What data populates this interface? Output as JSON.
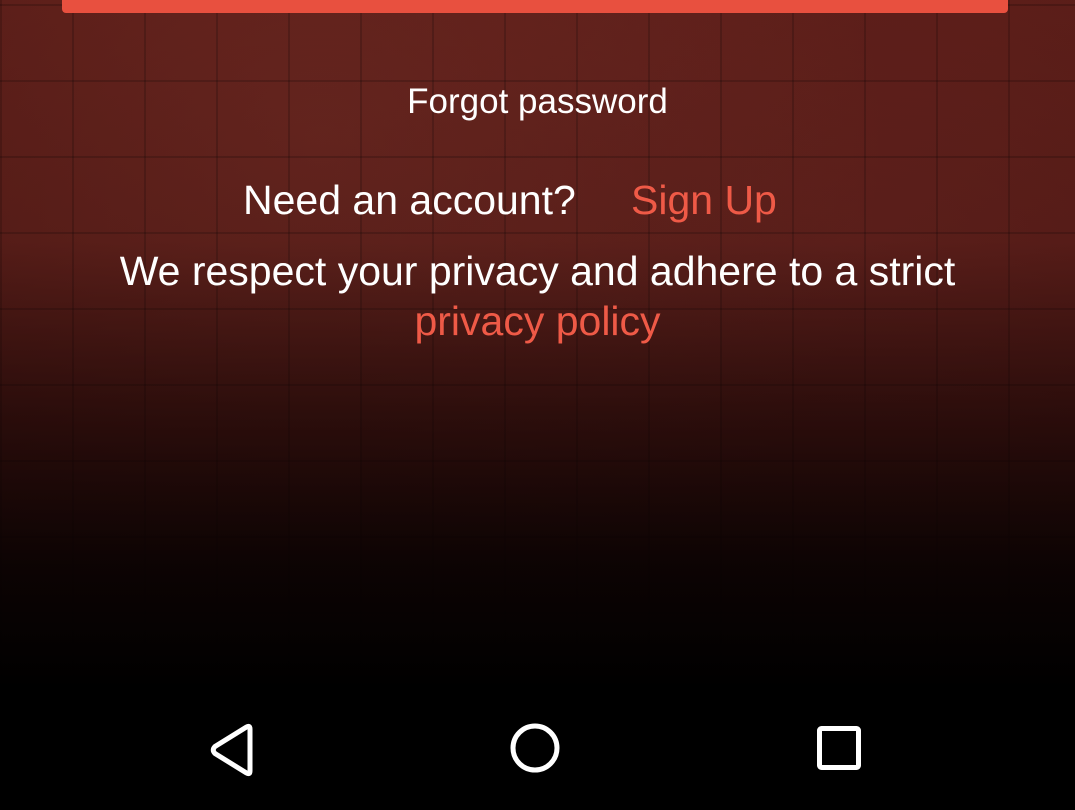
{
  "login": {
    "button_color": "#e8503f"
  },
  "links": {
    "forgot_password": "Forgot password",
    "need_account": "Need an account?",
    "sign_up": "Sign Up",
    "privacy_text": "We respect your privacy and adhere to a strict",
    "privacy_link": "privacy policy",
    "accent_color": "#ef5a47"
  },
  "navbar": {
    "buttons": [
      {
        "icon": "back-triangle-icon"
      },
      {
        "icon": "home-circle-icon"
      },
      {
        "icon": "recents-square-icon"
      }
    ]
  }
}
